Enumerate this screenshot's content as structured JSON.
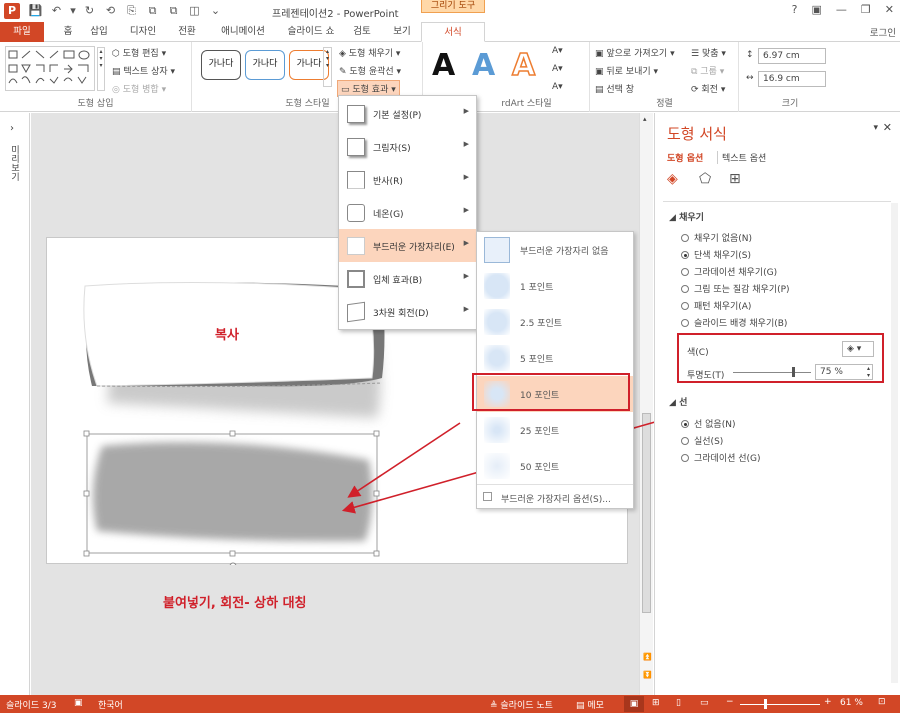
{
  "window": {
    "title": "프레젠테이션2 - PowerPoint",
    "context_tab": "그리기 도구",
    "app_icon": "P",
    "controls": [
      "?",
      "▣",
      "—",
      "❐",
      "✕"
    ]
  },
  "qat": [
    "save-icon",
    "undo-icon",
    "redo-icon",
    "repeat-icon",
    "copy-format-icon",
    "ungroup-icon",
    "group-icon",
    "merge-icon",
    "more-icon"
  ],
  "tabs": [
    "파일",
    "홈",
    "삽입",
    "디자인",
    "전환",
    "애니메이션",
    "슬라이드 쇼",
    "검토",
    "보기",
    "서식"
  ],
  "login": "로그인",
  "ribbon": {
    "insert_shapes": {
      "label": "도형 삽입",
      "edit_shape": "도형 편집",
      "text_box": "텍스트 상자",
      "merge_shapes": "도형 병합"
    },
    "shape_styles": {
      "label": "도형 스타일",
      "preset": "가나다",
      "fill": "도형 채우기",
      "outline": "도형 윤곽선",
      "effects": "도형 효과"
    },
    "wordart": {
      "label": "WordArt 스타일",
      "partial_label": "rdArt 스타일"
    },
    "arrange": {
      "label": "정렬",
      "bring_forward": "앞으로 가져오기",
      "send_backward": "뒤로 보내기",
      "selection_pane": "선택 창",
      "align": "맞춤",
      "group": "그룹",
      "rotate": "회전"
    },
    "size": {
      "label": "크기",
      "height": "6.97 cm",
      "width": "16.9 cm"
    }
  },
  "effects_menu": [
    {
      "label": "기본 설정(P)",
      "highlight": false
    },
    {
      "label": "그림자(S)",
      "highlight": false
    },
    {
      "label": "반사(R)",
      "highlight": false
    },
    {
      "label": "네온(G)",
      "highlight": false
    },
    {
      "label": "부드러운 가장자리(E)",
      "highlight": true
    },
    {
      "label": "입체 효과(B)",
      "highlight": false
    },
    {
      "label": "3차원 회전(D)",
      "highlight": false
    }
  ],
  "soft_edges_menu": {
    "items": [
      "부드러운 가장자리 없음",
      "1 포인트",
      "2.5 포인트",
      "5 포인트",
      "10 포인트",
      "25 포인트",
      "50 포인트"
    ],
    "options": "부드러운 가장자리 옵션(S)...",
    "highlighted_index": 4
  },
  "slide": {
    "shape_text": "복사",
    "annotation": "붙여넣기, 회전- 상하 대칭"
  },
  "left_pane_label": "미리보기",
  "format_pane": {
    "title": "도형 서식",
    "tab_shape": "도형 옵션",
    "tab_text": "텍스트 옵션",
    "fill_section": "채우기",
    "fill_options": [
      {
        "label": "채우기 없음(N)",
        "selected": false
      },
      {
        "label": "단색 채우기(S)",
        "selected": true
      },
      {
        "label": "그라데이션 채우기(G)",
        "selected": false
      },
      {
        "label": "그림 또는 질감 채우기(P)",
        "selected": false
      },
      {
        "label": "패턴 채우기(A)",
        "selected": false
      },
      {
        "label": "슬라이드 배경 채우기(B)",
        "selected": false
      }
    ],
    "color_label": "색(C)",
    "transparency_label": "투명도(T)",
    "transparency_value": "75 %",
    "transparency": 0.75,
    "line_section": "선",
    "line_options": [
      {
        "label": "선 없음(N)",
        "selected": true
      },
      {
        "label": "실선(S)",
        "selected": false
      },
      {
        "label": "그라데이션 선(G)",
        "selected": false
      }
    ]
  },
  "status": {
    "slide": "슬라이드 3/3",
    "language": "한국어",
    "notes": "슬라이드 노트",
    "comments": "메모",
    "zoom": "61 %"
  },
  "colors": {
    "accent": "#d24726",
    "highlight": "#fcd5bd",
    "annotation_red": "#d0202a"
  }
}
